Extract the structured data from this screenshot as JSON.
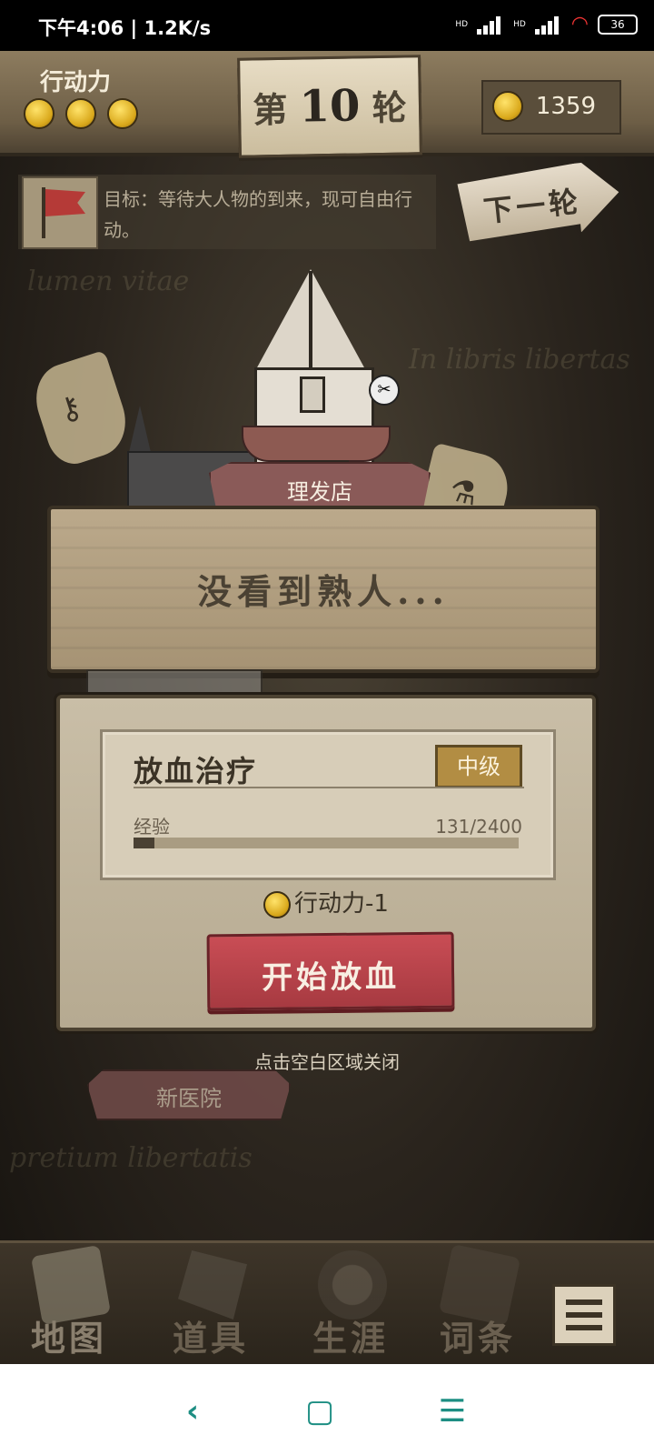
{
  "status_bar": {
    "time": "下午4:06",
    "speed": "1.2K/s",
    "net1": "HD",
    "net2": "HD",
    "battery": "36"
  },
  "top": {
    "action_points_label": "行动力",
    "action_points_count": 3,
    "round_prefix": "第",
    "round_number": "10",
    "round_suffix": "轮",
    "gold": "1359"
  },
  "objective": {
    "text": "目标：等待大人物的到来，现可自由行动。"
  },
  "next_round_label": "下一轮",
  "map": {
    "shop_name": "理发店",
    "hospital_name": "新医院",
    "bg_text_1": "lumen vitae",
    "bg_text_2": "In libris libertas",
    "bg_text_3": "pretium libertatis"
  },
  "sign_message": "没看到熟人...",
  "skill": {
    "name": "放血治疗",
    "rank": "中级",
    "xp_label": "经验",
    "xp_value": "131/2400",
    "xp_fraction": 0.055,
    "cost_text": "行动力-1",
    "start_button": "开始放血"
  },
  "close_hint": "点击空白区域关闭",
  "bottom_nav": {
    "map": "地图",
    "items": "道具",
    "career": "生涯",
    "terms": "词条"
  },
  "colors": {
    "accent_red": "#b8434a",
    "gold": "#d9a81b",
    "parchment": "#c9bea7"
  }
}
